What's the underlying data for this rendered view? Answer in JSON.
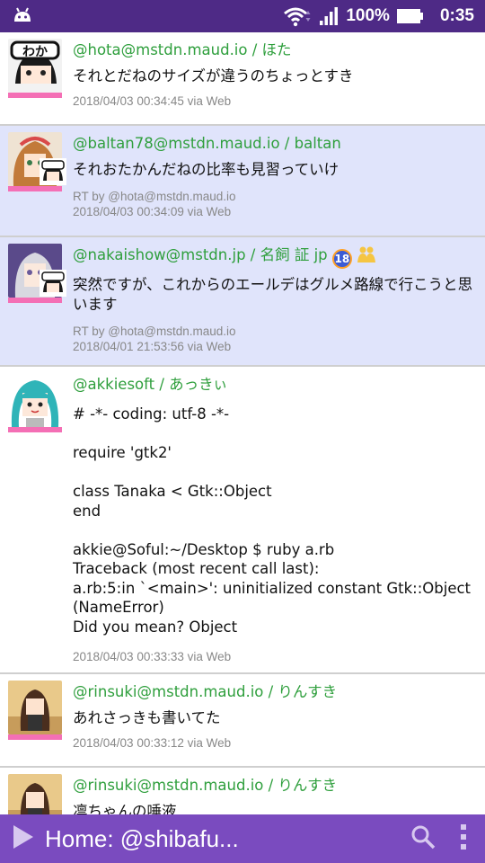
{
  "status_bar": {
    "battery_percent": "100%",
    "time": "0:35",
    "icons": [
      "android-icon",
      "wifi-icon",
      "signal-icon",
      "battery-icon"
    ]
  },
  "timeline": [
    {
      "account": "@hota@mstdn.maud.io / ほた",
      "content": "それとだねのサイズが違うのちょっとすき",
      "rt_by": "",
      "timestamp": "2018/04/03 00:34:45 via Web",
      "reblog": false
    },
    {
      "account": "@baltan78@mstdn.maud.io / baltan",
      "content": "それおたかんだねの比率も見習っていけ",
      "rt_by": "RT by @hota@mstdn.maud.io",
      "timestamp": "2018/04/03 00:34:09 via Web",
      "reblog": true
    },
    {
      "account": "@nakaishow@mstdn.jp / 名飼 証 jp",
      "content": "突然ですが、これからのエールデはグルメ路線で行こうと思います",
      "rt_by": "RT by @hota@mstdn.maud.io",
      "timestamp": "2018/04/01 21:53:56 via Web",
      "reblog": true,
      "badge": "18"
    },
    {
      "account": "@akkiesoft / あっきぃ",
      "content": "# -*- coding: utf-8 -*-\n\nrequire 'gtk2'\n\nclass Tanaka < Gtk::Object\nend\n\nakkie@Soful:~/Desktop $ ruby a.rb\nTraceback (most recent call last):\na.rb:5:in `<main>': uninitialized constant Gtk::Object (NameError)\nDid you mean? Object",
      "rt_by": "",
      "timestamp": "2018/04/03 00:33:33 via Web",
      "reblog": false
    },
    {
      "account": "@rinsuki@mstdn.maud.io / りんすき",
      "content": "あれさっきも書いてた",
      "rt_by": "",
      "timestamp": "2018/04/03 00:33:12 via Web",
      "reblog": false
    },
    {
      "account": "@rinsuki@mstdn.maud.io / りんすき",
      "content": "凛ちゃんの唾液",
      "rt_by": "",
      "timestamp": "",
      "reblog": false
    }
  ],
  "bottom_bar": {
    "title": "Home: @shibafu...",
    "icons": [
      "play-icon",
      "search-icon",
      "overflow-menu-icon"
    ]
  },
  "colors": {
    "status_bar": "#4e2a86",
    "bottom_bar": "#7a4bbf",
    "account_green": "#2f9f3d",
    "reblog_bg": "#e0e4fb",
    "avatar_underline": "#f46fb5"
  }
}
